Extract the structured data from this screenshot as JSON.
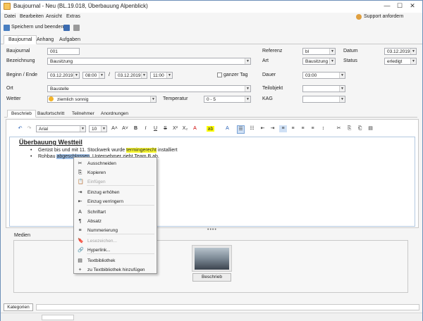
{
  "window": {
    "title": "Baujournal - Neu (BL.19.018, Überbauung Alpenblick)",
    "controls": {
      "minimize": "—",
      "maximize": "☐",
      "close": "✕"
    }
  },
  "menu": {
    "items": [
      "Datei",
      "Bearbeiten",
      "Ansicht",
      "Extras"
    ],
    "support": "Support anfordern"
  },
  "toolbar": {
    "save_close": "Speichern und beenden"
  },
  "main_tabs": [
    "Baujournal",
    "Anhang",
    "Aufgaben"
  ],
  "form": {
    "baujournal_label": "Baujournal",
    "baujournal_value": "001",
    "bezeichnung_label": "Bezeichnung",
    "bezeichnung_value": "Bausitzung",
    "beginn_label": "Beginn / Ende",
    "beginn_date": "03.12.2019",
    "beginn_time": "08:00",
    "sep": "/",
    "ende_date": "03.12.2019",
    "ende_time": "11:00",
    "ganzer_tag": "ganzer Tag",
    "ort_label": "Ort",
    "ort_value": "Baustelle",
    "wetter_label": "Wetter",
    "wetter_value": "ziemlich sonnig",
    "temperatur_label": "Temperatur",
    "temperatur_value": "0 - 5",
    "referenz_label": "Referenz",
    "referenz_value": "bl",
    "datum_label": "Datum",
    "datum_value": "03.12.2019",
    "art_label": "Art",
    "art_value": "Bausitzung",
    "status_label": "Status",
    "status_value": "erledigt",
    "dauer_label": "Dauer",
    "dauer_value": "03:00",
    "teilobjekt_label": "Teilobjekt",
    "teilobjekt_value": "",
    "kag_label": "KAG",
    "kag_value": ""
  },
  "sub_tabs": [
    "Beschrieb",
    "Baufortschritt",
    "Teilnehmer",
    "Anordnungen"
  ],
  "editor": {
    "font": "Arial",
    "size": "10",
    "heading": "Überbauung Westteil",
    "line1_pre": "Gerüst bis und mit 11. Stockwerk wurde ",
    "line1_hl": "termingerecht",
    "line1_post": " installiert",
    "line2_pre": "Rohbau ",
    "line2_sel": "abgeschlossen",
    "line2_post": ". Unternehmer zieht Team B ab."
  },
  "media": {
    "label": "Medien",
    "browse": "Beschrieb"
  },
  "status": {
    "kategorien": "Kategorien"
  },
  "context_menu": [
    {
      "label": "Ausschneiden",
      "icon": "✂",
      "disabled": false
    },
    {
      "label": "Kopieren",
      "icon": "⎘",
      "disabled": false
    },
    {
      "label": "Einfügen",
      "icon": "📋",
      "disabled": true
    },
    {
      "label": "Einzug erhöhen",
      "icon": "⇥",
      "disabled": false
    },
    {
      "label": "Einzug verringern",
      "icon": "⇤",
      "disabled": false
    },
    {
      "label": "Schriftart",
      "icon": "A",
      "disabled": false
    },
    {
      "label": "Absatz",
      "icon": "¶",
      "disabled": false
    },
    {
      "label": "Nummerierung",
      "icon": "≡",
      "disabled": false
    },
    {
      "label": "Lesezeichen...",
      "icon": "🔖",
      "disabled": true
    },
    {
      "label": "Hyperlink...",
      "icon": "🔗",
      "disabled": false
    },
    {
      "label": "Textbibliothek",
      "icon": "▤",
      "disabled": false
    },
    {
      "label": "zu Textbibliothek hinzufügen",
      "icon": "+",
      "disabled": false
    }
  ]
}
